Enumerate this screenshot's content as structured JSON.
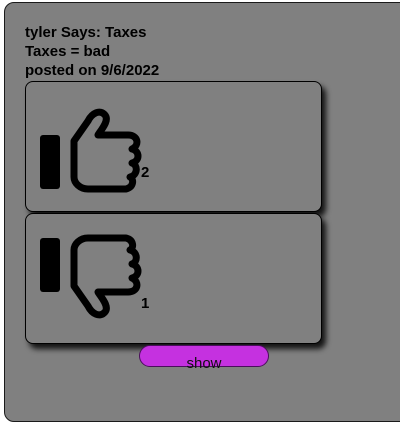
{
  "post": {
    "author_line": "tyler Says: Taxes",
    "body_line": "Taxes = bad",
    "date_line": "posted on 9/6/2022"
  },
  "votes": {
    "up": {
      "icon": "thumbs-up-icon",
      "count": "2"
    },
    "down": {
      "icon": "thumbs-down-icon",
      "count": "1"
    }
  },
  "actions": {
    "show_label": "show"
  },
  "colors": {
    "card_background": "#808080",
    "show_button": "#c531e0"
  }
}
